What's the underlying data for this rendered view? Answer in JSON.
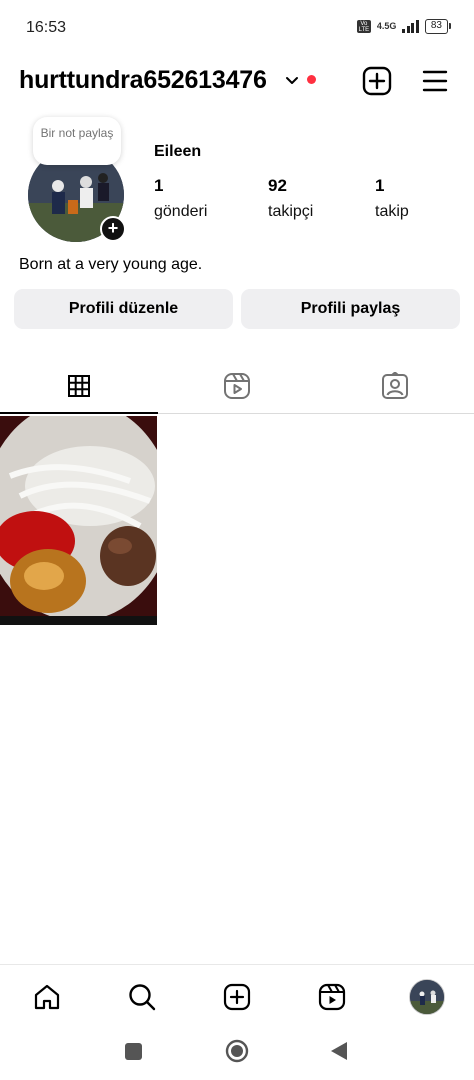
{
  "status_bar": {
    "time": "16:53",
    "volte": "Vo LTE",
    "network": "4.5G",
    "battery": "83"
  },
  "header": {
    "username": "hurttundra652613476",
    "accent_dot_color": "#ff3040"
  },
  "profile": {
    "note": "Bir not paylaş",
    "display_name": "Eileen",
    "stats": [
      {
        "value": "1",
        "label": "gönderi"
      },
      {
        "value": "92",
        "label": "takipçi"
      },
      {
        "value": "1",
        "label": "takip"
      }
    ],
    "bio": "Born at a very young age."
  },
  "buttons": {
    "edit_profile": "Profili düzenle",
    "share_profile": "Profili paylaş"
  },
  "tabs": [
    {
      "icon": "grid-icon",
      "active": true
    },
    {
      "icon": "reels-icon",
      "active": false
    },
    {
      "icon": "tagged-icon",
      "active": false
    }
  ],
  "posts": [
    {
      "icon": "post-thumbnail-food"
    }
  ],
  "bottom_nav": [
    {
      "icon": "home-icon"
    },
    {
      "icon": "search-icon"
    },
    {
      "icon": "create-icon"
    },
    {
      "icon": "reels-icon"
    },
    {
      "icon": "profile-avatar"
    }
  ],
  "system_nav": [
    {
      "icon": "recents-square-icon"
    },
    {
      "icon": "home-circle-icon"
    },
    {
      "icon": "back-triangle-icon"
    }
  ]
}
